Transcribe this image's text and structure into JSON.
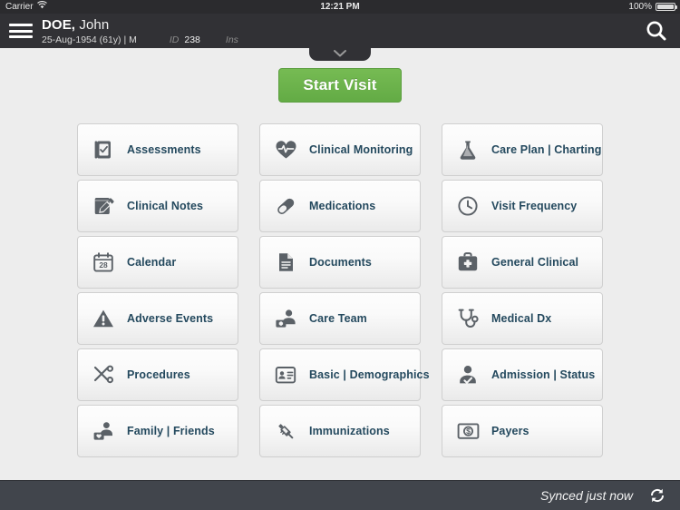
{
  "status_bar": {
    "carrier": "Carrier",
    "wifi_icon": "wifi-icon",
    "time": "12:21 PM",
    "battery_percent": "100%",
    "battery_icon": "battery-full-icon"
  },
  "header": {
    "menu_icon": "hamburger-menu-icon",
    "patient_family_name": "DOE,",
    "patient_given_name": "John",
    "dob_line": "25-Aug-1954 (61y) | M",
    "id_label": "ID",
    "id_value": "238",
    "ins_label": "Ins",
    "search_icon": "search-icon",
    "collapse_icon": "chevron-down-icon"
  },
  "main": {
    "start_visit_label": "Start Visit",
    "accent_green": "#6ab04c",
    "label_color": "#24495e",
    "tiles": [
      {
        "label": "Assessments",
        "icon": "clipboard-check-icon"
      },
      {
        "label": "Clinical Monitoring",
        "icon": "heart-pulse-icon"
      },
      {
        "label": "Care Plan | Charting",
        "icon": "flask-icon"
      },
      {
        "label": "Clinical Notes",
        "icon": "note-pencil-icon"
      },
      {
        "label": "Medications",
        "icon": "pill-capsule-icon"
      },
      {
        "label": "Visit Frequency",
        "icon": "clock-icon"
      },
      {
        "label": "Calendar",
        "icon": "calendar-icon",
        "icon_text": "28"
      },
      {
        "label": "Documents",
        "icon": "document-icon"
      },
      {
        "label": "General Clinical",
        "icon": "medical-bag-icon"
      },
      {
        "label": "Adverse Events",
        "icon": "warning-triangle-icon"
      },
      {
        "label": "Care Team",
        "icon": "care-team-icon"
      },
      {
        "label": "Medical Dx",
        "icon": "stethoscope-icon"
      },
      {
        "label": "Procedures",
        "icon": "scissors-scalpel-icon"
      },
      {
        "label": "Basic | Demographics",
        "icon": "id-card-icon"
      },
      {
        "label": "Admission | Status",
        "icon": "person-check-icon"
      },
      {
        "label": "Family | Friends",
        "icon": "family-icon"
      },
      {
        "label": "Immunizations",
        "icon": "syringe-icon"
      },
      {
        "label": "Payers",
        "icon": "dollar-bill-icon"
      }
    ]
  },
  "footer": {
    "sync_text": "Synced just now",
    "sync_icon": "sync-refresh-icon"
  }
}
